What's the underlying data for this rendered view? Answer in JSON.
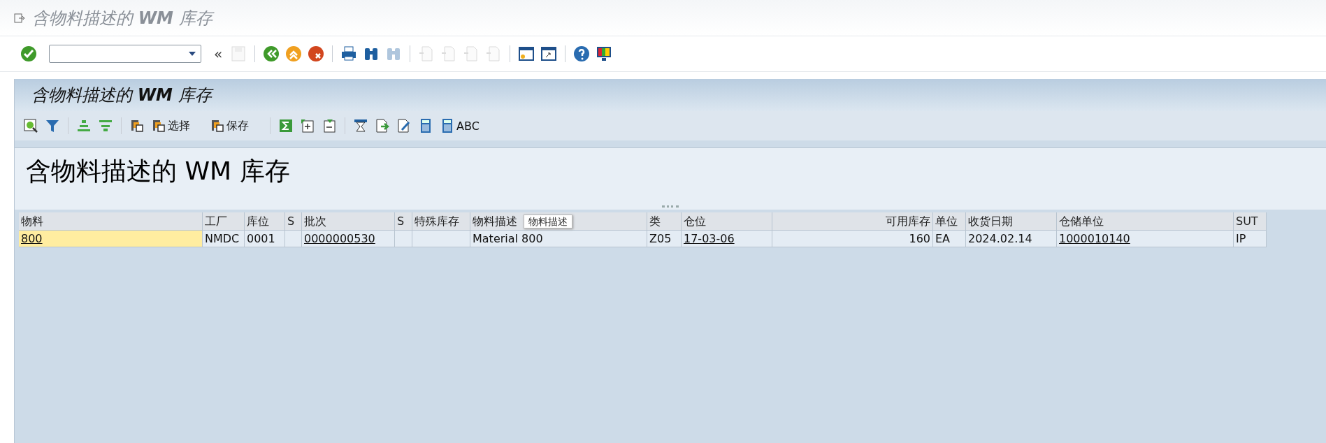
{
  "window": {
    "title": "含物料描述的 **WM** 库存"
  },
  "system_toolbar": [
    {
      "kind": "check",
      "disabled": false
    },
    {
      "kind": "command_field"
    },
    {
      "kind": "collapse",
      "label": "«"
    },
    {
      "kind": "save",
      "disabled": true
    },
    {
      "kind": "sep"
    },
    {
      "kind": "back",
      "disabled": false
    },
    {
      "kind": "exit",
      "disabled": false
    },
    {
      "kind": "cancel",
      "disabled": false
    },
    {
      "kind": "sep"
    },
    {
      "kind": "print",
      "disabled": false
    },
    {
      "kind": "find",
      "disabled": false
    },
    {
      "kind": "find",
      "disabled": true
    },
    {
      "kind": "sep"
    },
    {
      "kind": "page",
      "disabled": true
    },
    {
      "kind": "page",
      "disabled": true
    },
    {
      "kind": "page",
      "disabled": true
    },
    {
      "kind": "page",
      "disabled": true
    },
    {
      "kind": "sep"
    },
    {
      "kind": "window",
      "disabled": false
    },
    {
      "kind": "shortcut",
      "disabled": false
    },
    {
      "kind": "sep"
    },
    {
      "kind": "help",
      "disabled": false
    },
    {
      "kind": "monitor",
      "disabled": false
    }
  ],
  "screen_title": "含物料描述的 **WM** 库存",
  "app_toolbar": [
    {
      "kind": "details"
    },
    {
      "kind": "filter"
    },
    {
      "kind": "sep"
    },
    {
      "kind": "sort_up"
    },
    {
      "kind": "sort_down"
    },
    {
      "kind": "sep"
    },
    {
      "kind": "copy"
    },
    {
      "kind": "copy",
      "label": "选择"
    },
    {
      "kind": "gap"
    },
    {
      "kind": "copy",
      "label": "保存"
    },
    {
      "kind": "gap"
    },
    {
      "kind": "sep"
    },
    {
      "kind": "sum"
    },
    {
      "kind": "expand"
    },
    {
      "kind": "collapse"
    },
    {
      "kind": "sep"
    },
    {
      "kind": "hourglass"
    },
    {
      "kind": "export"
    },
    {
      "kind": "edit"
    },
    {
      "kind": "calc"
    },
    {
      "kind": "calc",
      "label": "ABC"
    }
  ],
  "report_title": "含物料描述的 WM 库存",
  "table": {
    "columns": [
      "物料",
      "工厂",
      "库位",
      "S",
      "批次",
      "S",
      "特殊库存",
      "物料描述",
      "类",
      "仓位",
      "可用库存",
      "单位",
      "收货日期",
      "仓储单位",
      "SUT"
    ],
    "rows": [
      {
        "cells": [
          {
            "text": "800",
            "link": true,
            "focused": true
          },
          {
            "text": "NMDC",
            "link": false,
            "focused": false
          },
          {
            "text": "0001",
            "link": false,
            "focused": false
          },
          {
            "text": ""
          },
          {
            "text": "0000000530",
            "link": true,
            "focused": false
          },
          {
            "text": ""
          },
          {
            "text": ""
          },
          {
            "text": "Material 800",
            "link": false,
            "focused": false
          },
          {
            "text": "Z05",
            "link": false,
            "focused": false
          },
          {
            "text": "17-03-06",
            "link": true,
            "focused": false
          },
          {
            "text": "160",
            "link": false,
            "focused": false
          },
          {
            "text": "EA",
            "link": false,
            "focused": false
          },
          {
            "text": "2024.02.14",
            "link": false,
            "focused": false
          },
          {
            "text": "1000010140",
            "link": true,
            "focused": false
          },
          {
            "text": "IP",
            "link": false,
            "focused": false
          }
        ]
      }
    ]
  },
  "tooltip": {
    "text": "物料描述"
  }
}
